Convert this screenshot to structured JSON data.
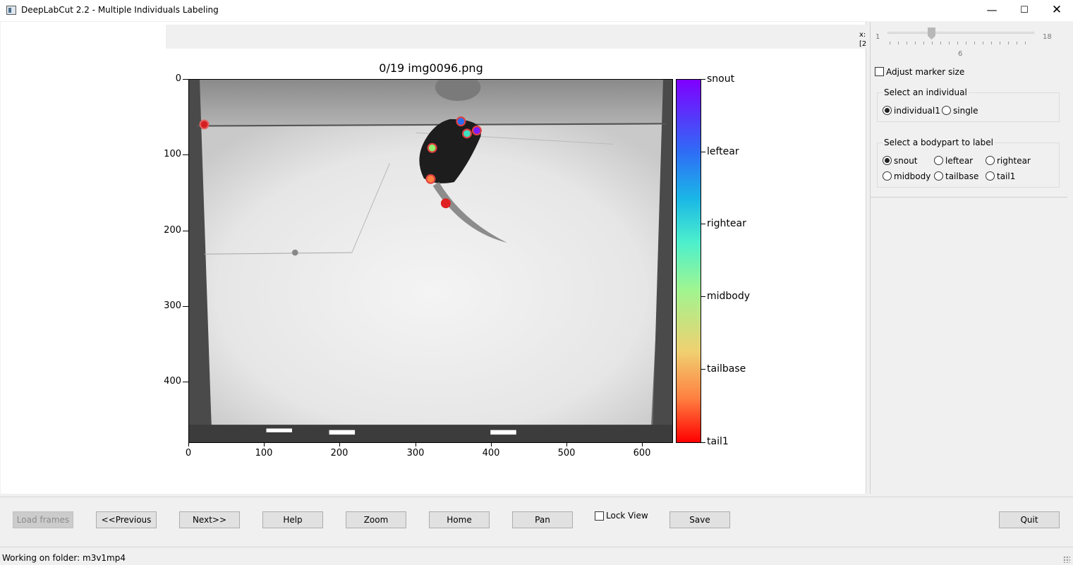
{
  "window": {
    "title": "DeepLabCut 2.2 - Multiple Individuals Labeling",
    "minimize_icon": "minimize-icon",
    "maximize_icon": "maximize-icon",
    "close_icon": "close-icon"
  },
  "figure": {
    "title": "0/19 img0096.png",
    "coord_readout": [
      "x:",
      "[2"
    ],
    "y_ticks": [
      "0",
      "100",
      "200",
      "300",
      "400"
    ],
    "x_ticks": [
      "0",
      "100",
      "200",
      "300",
      "400",
      "500",
      "600"
    ],
    "image_size": [
      640,
      480
    ],
    "colorbar_labels": [
      "snout",
      "leftear",
      "rightear",
      "midbody",
      "tailbase",
      "tail1"
    ],
    "colormap_colors": [
      "#7f00ff",
      "#2e6df6",
      "#1ab8e6",
      "#4df0cc",
      "#a0f590",
      "#f0d070",
      "#ff7f40",
      "#ff0000"
    ],
    "markers": [
      {
        "x": 20,
        "y": 59,
        "fill": "#d42020",
        "ring": "#e36060"
      },
      {
        "x": 359,
        "y": 55,
        "fill": "#2a6cf0",
        "ring": "#e04040"
      },
      {
        "x": 380,
        "y": 67,
        "fill": "#7a1cff",
        "ring": "#e04040"
      },
      {
        "x": 367,
        "y": 71,
        "fill": "#3fe0c0",
        "ring": "#e04040"
      },
      {
        "x": 321,
        "y": 90,
        "fill": "#90f070",
        "ring": "#e04040"
      },
      {
        "x": 319,
        "y": 131,
        "fill": "#ff8040",
        "ring": "#e04040"
      },
      {
        "x": 339,
        "y": 163,
        "fill": "#e02020",
        "ring": "#e02020"
      }
    ]
  },
  "right_panel": {
    "slider": {
      "min": "1",
      "max": "18",
      "value": "6"
    },
    "adjust_marker_label": "Adjust marker size",
    "individual_group": {
      "title": "Select an individual",
      "options": [
        "individual1",
        "single"
      ],
      "selected": "individual1"
    },
    "bodypart_group": {
      "title": "Select a bodypart to label",
      "options": [
        "snout",
        "leftear",
        "rightear",
        "midbody",
        "tailbase",
        "tail1"
      ],
      "selected": "snout"
    }
  },
  "buttons": {
    "load_frames": "Load frames",
    "previous": "<<Previous",
    "next": "Next>>",
    "help": "Help",
    "zoom": "Zoom",
    "home": "Home",
    "pan": "Pan",
    "lock_view": "Lock View",
    "save": "Save",
    "quit": "Quit"
  },
  "status": {
    "text": "Working on folder: m3v1mp4"
  }
}
